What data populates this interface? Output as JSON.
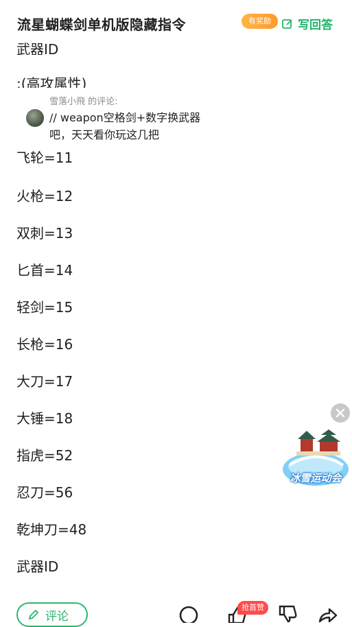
{
  "header": {
    "title": "流星蝴蝶剑单机版隐藏指令",
    "reward_badge": "有奖励",
    "answer_label": "写回答"
  },
  "content": {
    "partial_top": "武器ID",
    "partial_second": ":(高攻属性)",
    "partial_third": "飞轮=11",
    "lines": [
      "火枪=12",
      "双刺=13",
      "匕首=14",
      "轻剑=15",
      "长枪=16",
      "大刀=17",
      "大锤=18",
      "指虎=52",
      "忍刀=56",
      "乾坤刀=48",
      "武器ID"
    ]
  },
  "comment_popup": {
    "author": "雪落小飛 的评论:",
    "text": "// weapon空格剑+数字换武器吧，天天看你玩这几把"
  },
  "ad": {
    "label": "冰雪运动会"
  },
  "bottom_bar": {
    "comment_label": "评论",
    "first_like_badge": "抢首赞"
  },
  "colors": {
    "accent_green": "#2cb76e",
    "badge_orange": "#ff9a2b",
    "badge_red": "#ff4b4b"
  }
}
